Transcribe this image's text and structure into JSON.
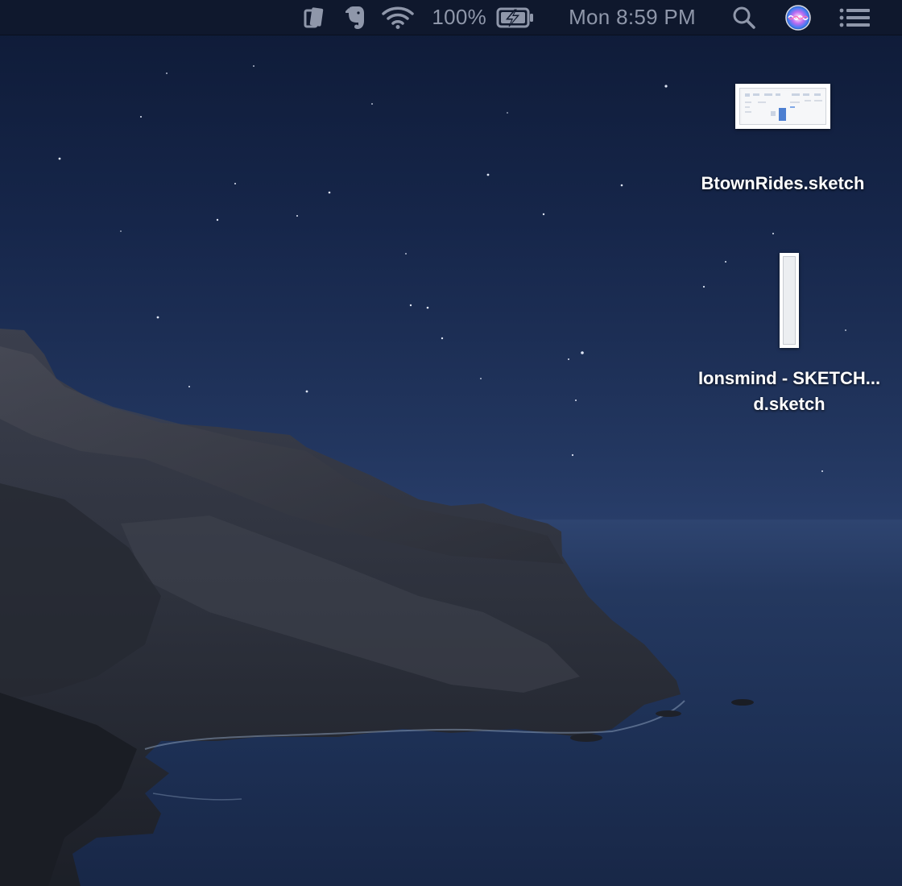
{
  "menubar": {
    "status_icons": [
      {
        "name": "pastebot-icon"
      },
      {
        "name": "evernote-icon"
      },
      {
        "name": "wifi-icon"
      }
    ],
    "battery_percent_label": "100%",
    "battery_icon": "battery-charging-icon",
    "clock": "Mon 8:59 PM",
    "spotlight_icon": "search-icon",
    "siri_icon": "siri-icon",
    "notification_center_icon": "list-icon"
  },
  "desktop": {
    "files": [
      {
        "label": "BtownRides.sketch",
        "thumbnail": "wide"
      },
      {
        "label": "Ionsmind - SKETCH...d.sketch",
        "thumbnail": "tall"
      }
    ]
  },
  "colors": {
    "menubar_bg": "#0f182d",
    "menubar_text": "#8f97aa",
    "label_text": "#ffffff"
  }
}
